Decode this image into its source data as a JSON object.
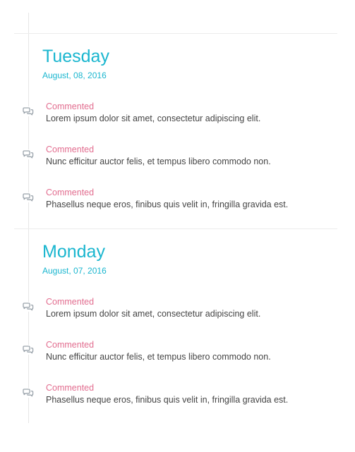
{
  "days": [
    {
      "title": "Tuesday",
      "date": "August, 08, 2016",
      "entries": [
        {
          "action": "Commented",
          "text": "Lorem ipsum dolor sit amet, consectetur adipiscing elit.",
          "icon": "comments-icon"
        },
        {
          "action": "Commented",
          "text": "Nunc efficitur auctor felis, et tempus libero commodo non.",
          "icon": "comments-icon"
        },
        {
          "action": "Commented",
          "text": "Phasellus neque eros, finibus quis velit in, fringilla gravida est.",
          "icon": "comments-icon"
        }
      ]
    },
    {
      "title": "Monday",
      "date": "August, 07, 2016",
      "entries": [
        {
          "action": "Commented",
          "text": "Lorem ipsum dolor sit amet, consectetur adipiscing elit.",
          "icon": "comments-icon"
        },
        {
          "action": "Commented",
          "text": "Nunc efficitur auctor felis, et tempus libero commodo non.",
          "icon": "comments-icon"
        },
        {
          "action": "Commented",
          "text": "Phasellus neque eros, finibus quis velit in, fringilla gravida est.",
          "icon": "comments-icon"
        }
      ]
    }
  ],
  "colors": {
    "accent": "#1ab6cf",
    "action": "#e26d8f",
    "text": "#444444",
    "line": "#e6e6e6",
    "icon": "#9aa3ab"
  }
}
